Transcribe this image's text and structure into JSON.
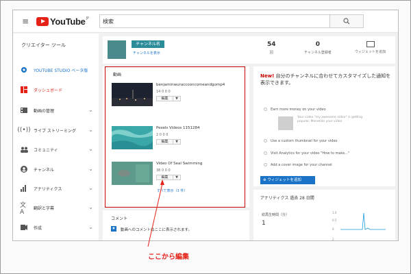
{
  "header": {
    "logo_text": "YouTube",
    "logo_suffix": "JP",
    "search_value": "検索",
    "search_button_icon": "search-icon"
  },
  "sidebar": {
    "title": "クリエイター ツール",
    "items": [
      {
        "label": "YOUTUBE STUDIO ベータ版",
        "icon": "gear-icon"
      },
      {
        "label": "ダッシュボード",
        "icon": "dashboard-icon"
      },
      {
        "label": "動画の管理",
        "icon": "video-manager-icon"
      },
      {
        "label": "ライブ ストリーミング",
        "icon": "live-icon"
      },
      {
        "label": "コミュニティ",
        "icon": "community-icon"
      },
      {
        "label": "チャンネル",
        "icon": "channel-icon"
      },
      {
        "label": "アナリティクス",
        "icon": "analytics-icon"
      },
      {
        "label": "翻訳と字幕",
        "icon": "translate-icon"
      },
      {
        "label": "作成",
        "icon": "create-icon"
      }
    ]
  },
  "channel": {
    "name": "チャンネル名",
    "sub_link": "チャンネルを表示",
    "stats": [
      {
        "value": "54",
        "label": "回"
      },
      {
        "value": "0",
        "label": "チャンネル登録者"
      }
    ],
    "widget_label": "ウィジェットを追加"
  },
  "videos": {
    "title": "動画",
    "items": [
      {
        "title": "benjaminwuraccooncomeandgomp4",
        "meta": "14    0    0    0"
      },
      {
        "title": "Pexels Videos 1151284",
        "meta": "2    0    0    0"
      },
      {
        "title": "Video Of Seal Swimming",
        "meta": "38    0    0    0"
      }
    ],
    "edit_label": "編集",
    "more_link": "すべて表示（3 件）"
  },
  "comments": {
    "title": "コメント",
    "text": "動画へのコメントはここに表示されます。"
  },
  "customize": {
    "new_label": "New!",
    "heading": "自分のチャンネルに合わせてカスタマイズした通知を表示できます。",
    "options": [
      "Earn more money on your video",
      "Use a custom thumbnail for your video",
      "Visit Analytics for your video \"How to make...\"",
      "Add a cover image for your channel"
    ],
    "preview_text": "Your video \"my awesome video\" is getting popular. Monetize your video",
    "button_label": "ウィジェットを追加"
  },
  "analytics": {
    "title": "アナリティクス  過去 28 日間",
    "metric_label": "総再生時間（分）",
    "metric_value": "1",
    "y_ticks": [
      "1.0",
      "0.5",
      "0",
      "2"
    ]
  },
  "annotation": {
    "text": "ここから編集"
  }
}
